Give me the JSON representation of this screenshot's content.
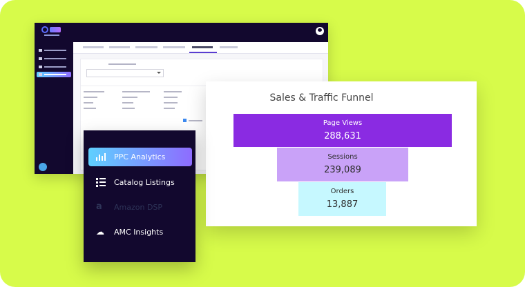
{
  "funnel": {
    "title": "Sales & Traffic Funnel",
    "steps": [
      {
        "label": "Page Views",
        "value": "288,631",
        "color": "#8a2be2"
      },
      {
        "label": "Sessions",
        "value": "239,089",
        "color": "#c9a2f8"
      },
      {
        "label": "Orders",
        "value": "13,887",
        "color": "#c6f8ff"
      }
    ]
  },
  "menu": {
    "items": [
      {
        "label": "PPC Analytics",
        "icon": "bar-chart-icon",
        "active": true
      },
      {
        "label": "Catalog Listings",
        "icon": "list-icon",
        "active": false
      },
      {
        "label": "Amazon DSP",
        "icon": "amazon-icon",
        "active": false,
        "disabled": true
      },
      {
        "label": "AMC Insights",
        "icon": "cloud-icon",
        "active": false
      }
    ]
  },
  "colors": {
    "background": "#d7fb4a",
    "dark": "#12082e",
    "accent_gradient_start": "#5fd0ff",
    "accent_gradient_end": "#8e6cff"
  }
}
